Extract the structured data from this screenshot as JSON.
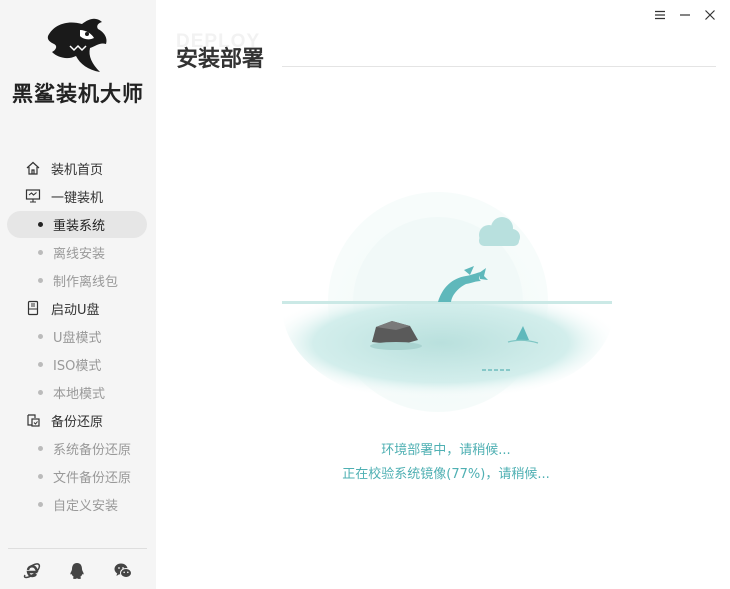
{
  "app": {
    "brand_name": "黑鲨装机大师"
  },
  "window_controls": {
    "menu_icon": "menu-icon",
    "minimize_icon": "minimize-icon",
    "close_icon": "close-icon"
  },
  "sidebar": {
    "groups": [
      {
        "label": "装机首页",
        "icon": "home-icon"
      },
      {
        "label": "一键装机",
        "icon": "monitor-icon",
        "items": [
          {
            "label": "重装系统",
            "active": true
          },
          {
            "label": "离线安装"
          },
          {
            "label": "制作离线包"
          }
        ]
      },
      {
        "label": "启动U盘",
        "icon": "usb-drive-icon",
        "items": [
          {
            "label": "U盘模式"
          },
          {
            "label": "ISO模式"
          },
          {
            "label": "本地模式"
          }
        ]
      },
      {
        "label": "备份还原",
        "icon": "backup-icon",
        "items": [
          {
            "label": "系统备份还原"
          },
          {
            "label": "文件备份还原"
          },
          {
            "label": "自定义安装"
          }
        ]
      }
    ],
    "footer_icons": [
      "ie-browser-icon",
      "qq-icon",
      "wechat-icon"
    ]
  },
  "main": {
    "title_watermark": "DEPLOY",
    "title": "安装部署",
    "status_line1": "环境部署中，请稍候...",
    "status_line2": "正在校验系统镜像(77%)，请稍候...",
    "progress_percent": 77
  },
  "colors": {
    "accent": "#4fb0b3",
    "sidebar_bg": "#f5f5f5",
    "sea": "#c3e6e3"
  }
}
